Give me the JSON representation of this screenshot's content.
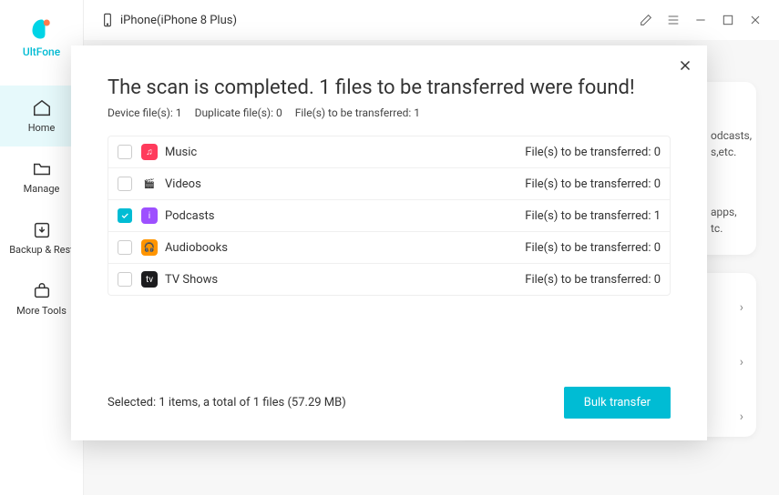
{
  "brand": "UltFone",
  "device_label": "iPhone(iPhone 8 Plus)",
  "nav": {
    "home": "Home",
    "manage": "Manage",
    "backup": "Backup & Rest",
    "tools": "More Tools"
  },
  "bg": {
    "line1": "odcasts,",
    "line2": "s,etc.",
    "line3": "apps,",
    "line4": "tc."
  },
  "modal": {
    "title": "The scan is completed. 1 files to be transferred were found!",
    "sub_device": "Device file(s): 1",
    "sub_dup": "Duplicate file(s): 0",
    "sub_trans": "File(s) to be transferred: 1",
    "rows": [
      {
        "name": "Music",
        "count": "File(s) to be transferred: 0",
        "checked": false,
        "icon": "icon-music",
        "glyph": "♫"
      },
      {
        "name": "Videos",
        "count": "File(s) to be transferred: 0",
        "checked": false,
        "icon": "icon-videos",
        "glyph": "🎬"
      },
      {
        "name": "Podcasts",
        "count": "File(s) to be transferred: 1",
        "checked": true,
        "icon": "icon-podcasts",
        "glyph": "i"
      },
      {
        "name": "Audiobooks",
        "count": "File(s) to be transferred: 0",
        "checked": false,
        "icon": "icon-audiobooks",
        "glyph": "🎧"
      },
      {
        "name": "TV Shows",
        "count": "File(s) to be transferred: 0",
        "checked": false,
        "icon": "icon-tvshows",
        "glyph": "tv"
      }
    ],
    "selected": "Selected: 1 items, a total of 1 files (57.29 MB)",
    "bulk": "Bulk transfer"
  }
}
